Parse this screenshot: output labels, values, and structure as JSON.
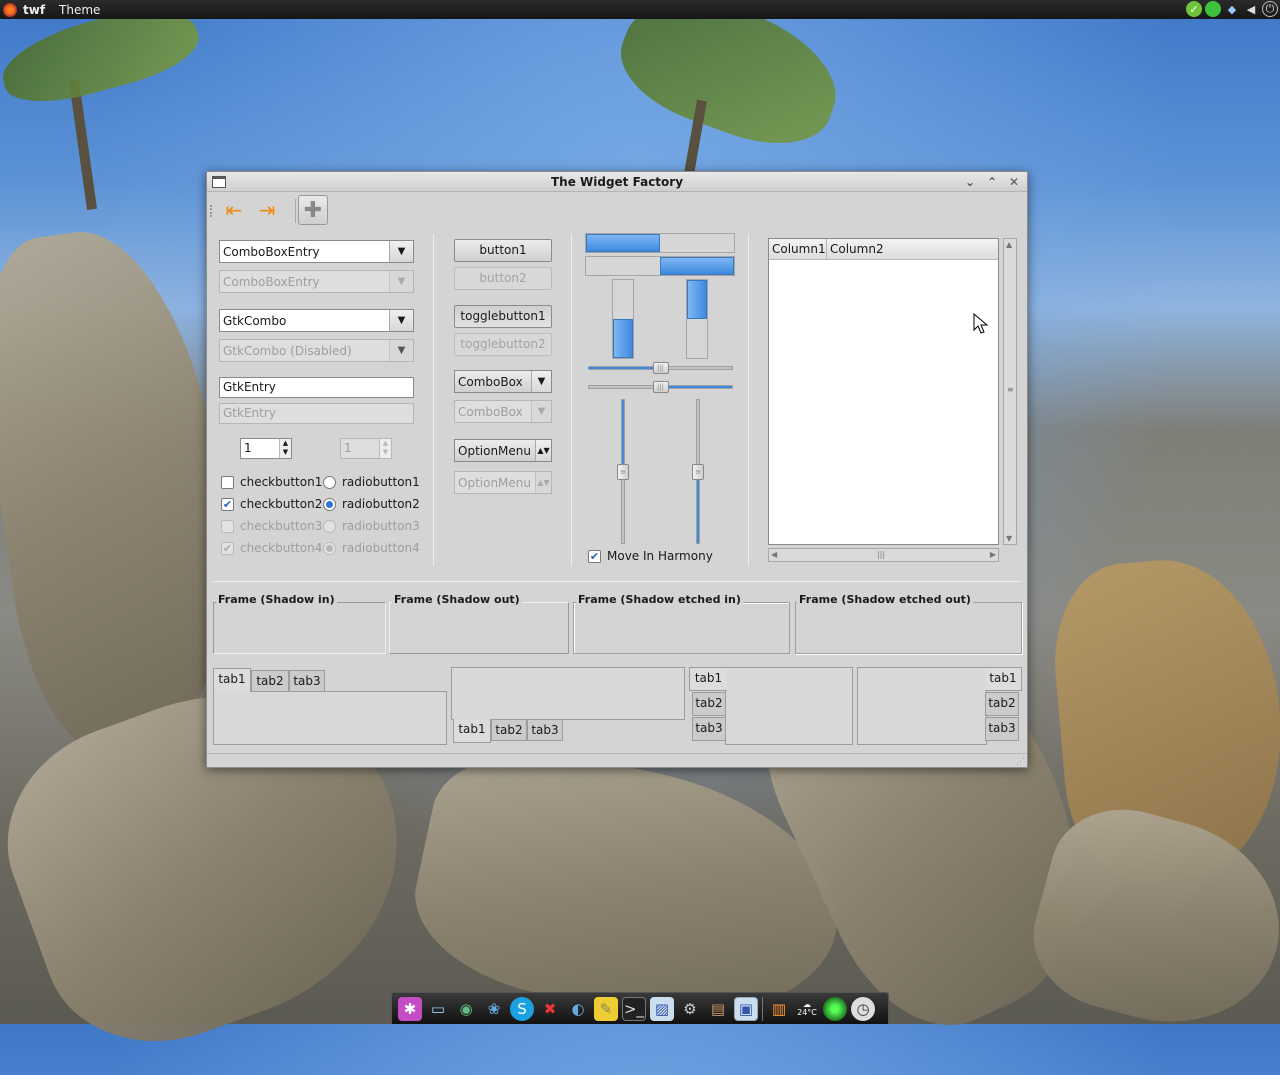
{
  "top_panel": {
    "app_name": "twf",
    "menu_theme": "Theme"
  },
  "window": {
    "title": "The Widget Factory"
  },
  "left_column": {
    "combo_entry": "ComboBoxEntry",
    "combo_entry_disabled": "ComboBoxEntry",
    "gtk_combo": "GtkCombo",
    "gtk_combo_disabled": "GtkCombo (Disabled)",
    "gtk_entry": "GtkEntry",
    "gtk_entry_disabled": "GtkEntry",
    "spin_value": "1",
    "spin_disabled_value": "1",
    "checkbutton1": "checkbutton1",
    "checkbutton2": "checkbutton2",
    "checkbutton3": "checkbutton3",
    "checkbutton4": "checkbutton4",
    "radiobutton1": "radiobutton1",
    "radiobutton2": "radiobutton2",
    "radiobutton3": "radiobutton3",
    "radiobutton4": "radiobutton4"
  },
  "middle_column": {
    "button1": "button1",
    "button2": "button2",
    "togglebutton1": "togglebutton1",
    "togglebutton2": "togglebutton2",
    "combobox": "ComboBox",
    "combobox_disabled": "ComboBox",
    "optionmenu": "OptionMenu",
    "optionmenu_disabled": "OptionMenu"
  },
  "range_column": {
    "progress_h1": 0.5,
    "progress_h2": 0.5,
    "progress_v1": 0.5,
    "progress_v2": 0.5,
    "scale_h1": 0.5,
    "scale_h2": 0.5,
    "scale_v1": 0.5,
    "scale_v2": 0.5,
    "move_in_harmony": "Move In Harmony"
  },
  "tree": {
    "column1": "Column1",
    "column2": "Column2"
  },
  "frames": {
    "shadow_in": "Frame (Shadow in)",
    "shadow_out": "Frame (Shadow out)",
    "shadow_etched_in": "Frame (Shadow etched in)",
    "shadow_etched_out": "Frame (Shadow etched out)"
  },
  "notebooks": {
    "top": [
      "tab1",
      "tab2",
      "tab3"
    ],
    "bottom": [
      "tab1",
      "tab2",
      "tab3"
    ],
    "left": [
      "tab1",
      "tab2",
      "tab3"
    ],
    "right": [
      "tab1",
      "tab2",
      "tab3"
    ]
  },
  "dock": {
    "weather_temp": "24°C"
  }
}
